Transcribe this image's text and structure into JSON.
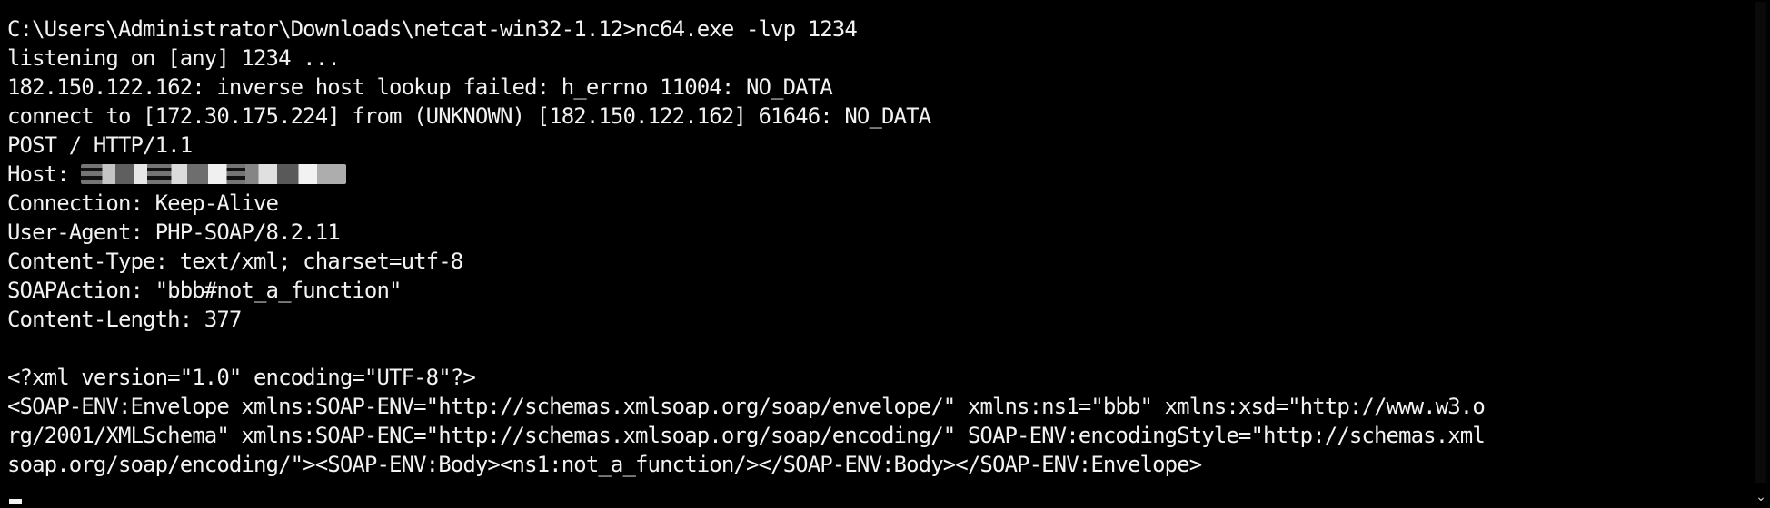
{
  "console": {
    "lines": [
      "C:\\Users\\Administrator\\Downloads\\netcat-win32-1.12>nc64.exe -lvp 1234",
      "listening on [any] 1234 ...",
      "182.150.122.162: inverse host lookup failed: h_errno 11004: NO_DATA",
      "connect to [172.30.175.224] from (UNKNOWN) [182.150.122.162] 61646: NO_DATA",
      "POST / HTTP/1.1",
      "Host: ",
      "Connection: Keep-Alive",
      "User-Agent: PHP-SOAP/8.2.11",
      "Content-Type: text/xml; charset=utf-8",
      "SOAPAction: \"bbb#not_a_function\"",
      "Content-Length: 377",
      "",
      "<?xml version=\"1.0\" encoding=\"UTF-8\"?>",
      "<SOAP-ENV:Envelope xmlns:SOAP-ENV=\"http://schemas.xmlsoap.org/soap/envelope/\" xmlns:ns1=\"bbb\" xmlns:xsd=\"http://www.w3.o",
      "rg/2001/XMLSchema\" xmlns:SOAP-ENC=\"http://schemas.xmlsoap.org/soap/encoding/\" SOAP-ENV:encodingStyle=\"http://schemas.xml",
      "soap.org/soap/encoding/\"><SOAP-ENV:Body><ns1:not_a_function/></SOAP-ENV:Body></SOAP-ENV:Envelope>"
    ]
  },
  "scrollbar": {
    "down_arrow": "⌄"
  },
  "colors": {
    "background": "#000000",
    "text": "#f2f2f2"
  }
}
